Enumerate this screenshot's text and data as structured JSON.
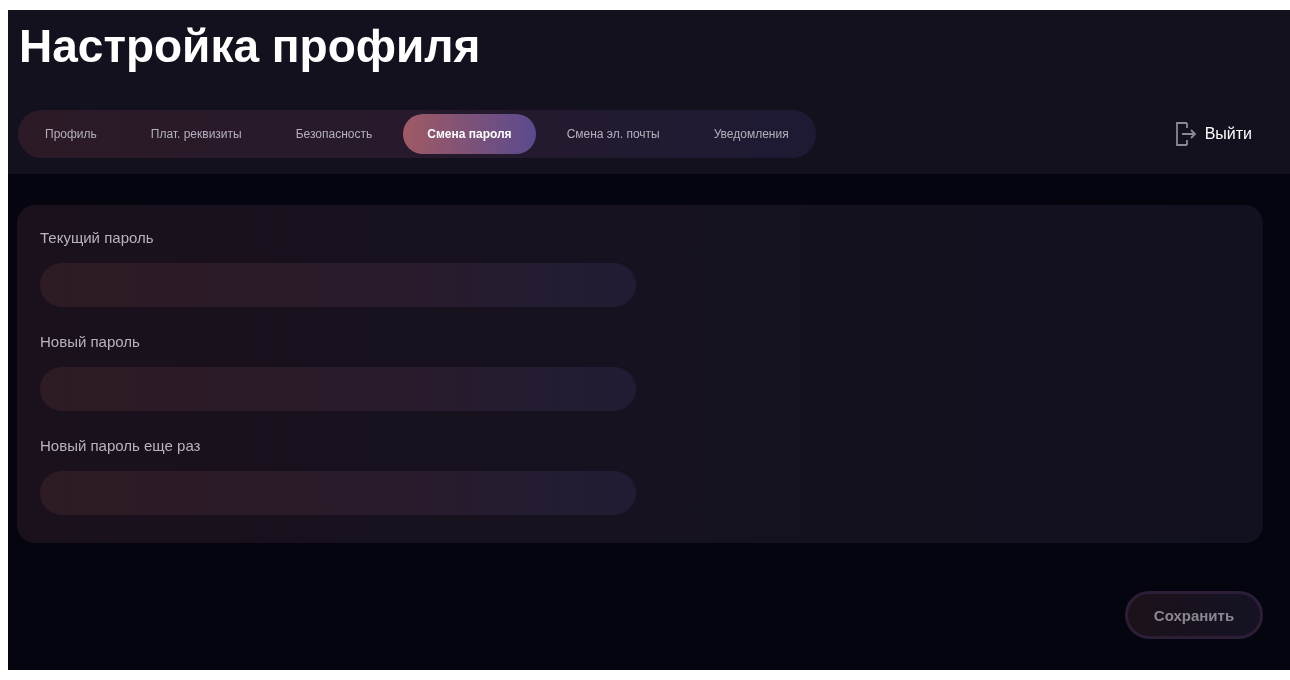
{
  "title": "Настройка профиля",
  "tabs": [
    {
      "label": "Профиль",
      "selected": false
    },
    {
      "label": "Плат. реквизиты",
      "selected": false
    },
    {
      "label": "Безопасность",
      "selected": false
    },
    {
      "label": "Смена пароля",
      "selected": true
    },
    {
      "label": "Смена эл. почты",
      "selected": false
    },
    {
      "label": "Уведомления",
      "selected": false
    }
  ],
  "logout": {
    "label": "Выйти"
  },
  "form": {
    "fields": [
      {
        "label": "Текущий пароль"
      },
      {
        "label": "Новый пароль"
      },
      {
        "label": "Новый пароль еще раз"
      }
    ]
  },
  "save_button": {
    "label": "Сохранить",
    "disabled": true
  }
}
